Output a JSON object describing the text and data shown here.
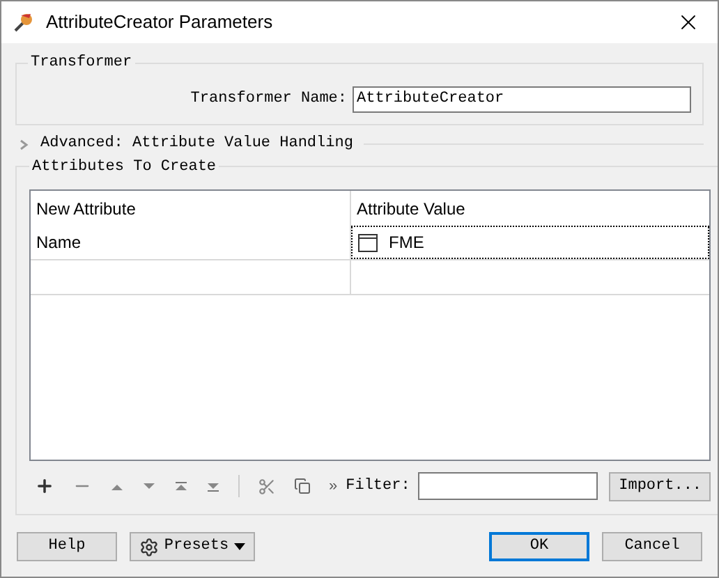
{
  "window": {
    "title": "AttributeCreator Parameters"
  },
  "transformer_group": {
    "title": "Transformer",
    "name_label": "Transformer Name:",
    "name_value": "AttributeCreator"
  },
  "advanced_section": {
    "label": "Advanced: Attribute Value Handling",
    "expanded": false
  },
  "attributes_group": {
    "title": "Attributes To Create",
    "table": {
      "columns": [
        "New Attribute",
        "Attribute Value"
      ],
      "rows": [
        {
          "cells": [
            "Name",
            "FME"
          ],
          "focused": true
        }
      ]
    },
    "toolbar": {
      "more": "»",
      "filter_label": "Filter:",
      "import_button": "Import..."
    }
  },
  "buttons": [
    {
      "kind": "help",
      "label": "Help",
      "default": false
    },
    {
      "kind": "presets",
      "label": "Presets",
      "default": false
    },
    {
      "kind": "ok",
      "label": "OK",
      "default": true
    },
    {
      "kind": "cancel",
      "label": "Cancel",
      "default": false
    }
  ]
}
